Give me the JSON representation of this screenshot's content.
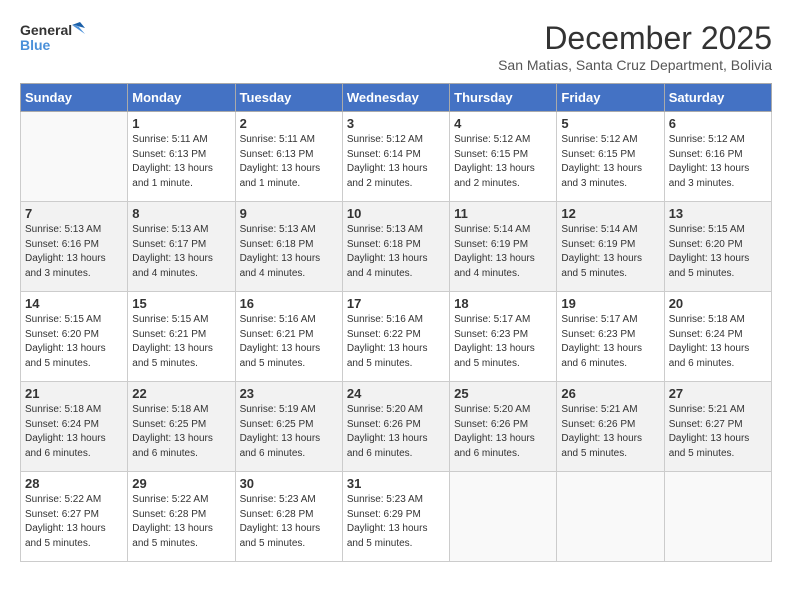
{
  "header": {
    "logo_line1": "General",
    "logo_line2": "Blue",
    "month": "December 2025",
    "location": "San Matias, Santa Cruz Department, Bolivia"
  },
  "days_of_week": [
    "Sunday",
    "Monday",
    "Tuesday",
    "Wednesday",
    "Thursday",
    "Friday",
    "Saturday"
  ],
  "weeks": [
    [
      {
        "num": "",
        "info": ""
      },
      {
        "num": "1",
        "info": "Sunrise: 5:11 AM\nSunset: 6:13 PM\nDaylight: 13 hours\nand 1 minute."
      },
      {
        "num": "2",
        "info": "Sunrise: 5:11 AM\nSunset: 6:13 PM\nDaylight: 13 hours\nand 1 minute."
      },
      {
        "num": "3",
        "info": "Sunrise: 5:12 AM\nSunset: 6:14 PM\nDaylight: 13 hours\nand 2 minutes."
      },
      {
        "num": "4",
        "info": "Sunrise: 5:12 AM\nSunset: 6:15 PM\nDaylight: 13 hours\nand 2 minutes."
      },
      {
        "num": "5",
        "info": "Sunrise: 5:12 AM\nSunset: 6:15 PM\nDaylight: 13 hours\nand 3 minutes."
      },
      {
        "num": "6",
        "info": "Sunrise: 5:12 AM\nSunset: 6:16 PM\nDaylight: 13 hours\nand 3 minutes."
      }
    ],
    [
      {
        "num": "7",
        "info": "Sunrise: 5:13 AM\nSunset: 6:16 PM\nDaylight: 13 hours\nand 3 minutes."
      },
      {
        "num": "8",
        "info": "Sunrise: 5:13 AM\nSunset: 6:17 PM\nDaylight: 13 hours\nand 4 minutes."
      },
      {
        "num": "9",
        "info": "Sunrise: 5:13 AM\nSunset: 6:18 PM\nDaylight: 13 hours\nand 4 minutes."
      },
      {
        "num": "10",
        "info": "Sunrise: 5:13 AM\nSunset: 6:18 PM\nDaylight: 13 hours\nand 4 minutes."
      },
      {
        "num": "11",
        "info": "Sunrise: 5:14 AM\nSunset: 6:19 PM\nDaylight: 13 hours\nand 4 minutes."
      },
      {
        "num": "12",
        "info": "Sunrise: 5:14 AM\nSunset: 6:19 PM\nDaylight: 13 hours\nand 5 minutes."
      },
      {
        "num": "13",
        "info": "Sunrise: 5:15 AM\nSunset: 6:20 PM\nDaylight: 13 hours\nand 5 minutes."
      }
    ],
    [
      {
        "num": "14",
        "info": "Sunrise: 5:15 AM\nSunset: 6:20 PM\nDaylight: 13 hours\nand 5 minutes."
      },
      {
        "num": "15",
        "info": "Sunrise: 5:15 AM\nSunset: 6:21 PM\nDaylight: 13 hours\nand 5 minutes."
      },
      {
        "num": "16",
        "info": "Sunrise: 5:16 AM\nSunset: 6:21 PM\nDaylight: 13 hours\nand 5 minutes."
      },
      {
        "num": "17",
        "info": "Sunrise: 5:16 AM\nSunset: 6:22 PM\nDaylight: 13 hours\nand 5 minutes."
      },
      {
        "num": "18",
        "info": "Sunrise: 5:17 AM\nSunset: 6:23 PM\nDaylight: 13 hours\nand 5 minutes."
      },
      {
        "num": "19",
        "info": "Sunrise: 5:17 AM\nSunset: 6:23 PM\nDaylight: 13 hours\nand 6 minutes."
      },
      {
        "num": "20",
        "info": "Sunrise: 5:18 AM\nSunset: 6:24 PM\nDaylight: 13 hours\nand 6 minutes."
      }
    ],
    [
      {
        "num": "21",
        "info": "Sunrise: 5:18 AM\nSunset: 6:24 PM\nDaylight: 13 hours\nand 6 minutes."
      },
      {
        "num": "22",
        "info": "Sunrise: 5:18 AM\nSunset: 6:25 PM\nDaylight: 13 hours\nand 6 minutes."
      },
      {
        "num": "23",
        "info": "Sunrise: 5:19 AM\nSunset: 6:25 PM\nDaylight: 13 hours\nand 6 minutes."
      },
      {
        "num": "24",
        "info": "Sunrise: 5:20 AM\nSunset: 6:26 PM\nDaylight: 13 hours\nand 6 minutes."
      },
      {
        "num": "25",
        "info": "Sunrise: 5:20 AM\nSunset: 6:26 PM\nDaylight: 13 hours\nand 6 minutes."
      },
      {
        "num": "26",
        "info": "Sunrise: 5:21 AM\nSunset: 6:26 PM\nDaylight: 13 hours\nand 5 minutes."
      },
      {
        "num": "27",
        "info": "Sunrise: 5:21 AM\nSunset: 6:27 PM\nDaylight: 13 hours\nand 5 minutes."
      }
    ],
    [
      {
        "num": "28",
        "info": "Sunrise: 5:22 AM\nSunset: 6:27 PM\nDaylight: 13 hours\nand 5 minutes."
      },
      {
        "num": "29",
        "info": "Sunrise: 5:22 AM\nSunset: 6:28 PM\nDaylight: 13 hours\nand 5 minutes."
      },
      {
        "num": "30",
        "info": "Sunrise: 5:23 AM\nSunset: 6:28 PM\nDaylight: 13 hours\nand 5 minutes."
      },
      {
        "num": "31",
        "info": "Sunrise: 5:23 AM\nSunset: 6:29 PM\nDaylight: 13 hours\nand 5 minutes."
      },
      {
        "num": "",
        "info": ""
      },
      {
        "num": "",
        "info": ""
      },
      {
        "num": "",
        "info": ""
      }
    ]
  ]
}
